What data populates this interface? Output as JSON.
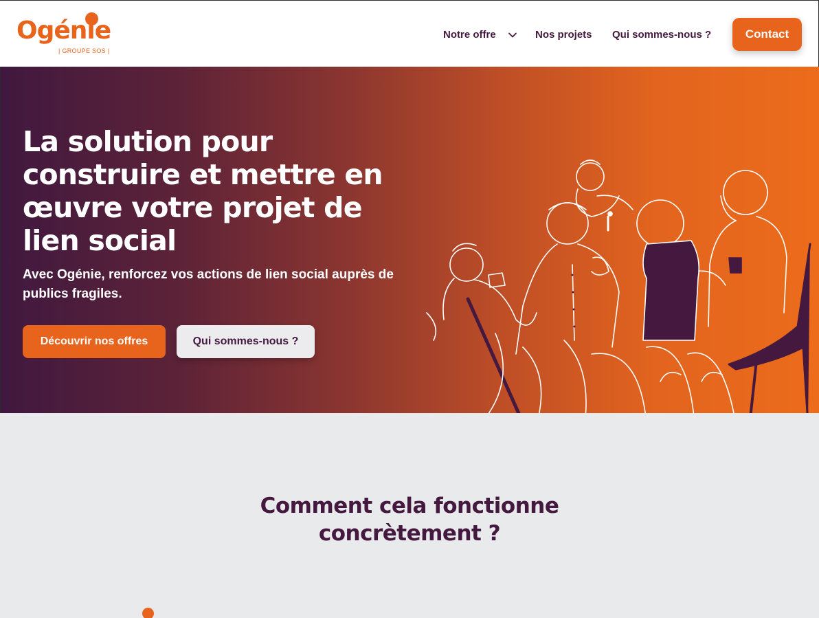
{
  "brand": {
    "name": "Ogénie",
    "tagline": "| GROUPE SOS |",
    "accent": "#e8641c",
    "dark": "#45193f"
  },
  "nav": {
    "items": [
      {
        "label": "Notre offre",
        "icon": "chevron-down-icon"
      },
      {
        "label": "Nos projets"
      },
      {
        "label": "Qui sommes-nous ?"
      }
    ],
    "contact_label": "Contact"
  },
  "hero": {
    "title": "La solution pour construire et mettre en œuvre votre projet de lien social",
    "subtitle": "Avec Ogénie, renforcez vos actions de lien social auprès de publics fragiles.",
    "primary_cta": "Découvrir nos offres",
    "secondary_cta": "Qui sommes-nous ?",
    "illustration": "people-group-illustration"
  },
  "section": {
    "title": "Comment cela fonctionne concrètement ?"
  }
}
